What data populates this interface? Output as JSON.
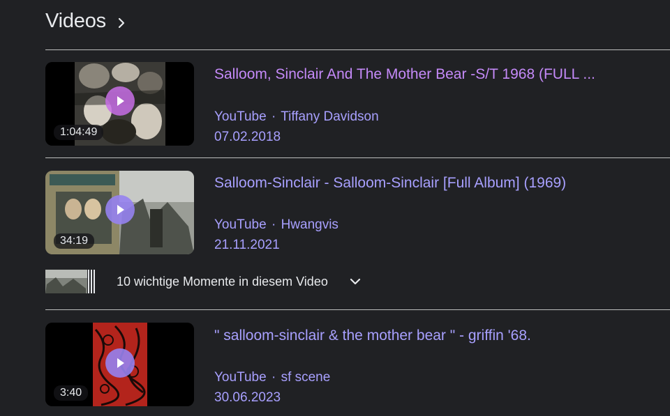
{
  "header": {
    "title": "Videos",
    "chevron_icon": "chevron-right-icon"
  },
  "colors": {
    "background": "#202124",
    "visited_link": "#c58af9",
    "link": "#8ab4f8",
    "meta": "#a8a0ff",
    "text": "#e8eaed"
  },
  "videos": [
    {
      "title": "Salloom, Sinclair And The Mother Bear -S/T 1968 (FULL ...",
      "source": "YouTube",
      "separator": "·",
      "channel": "Tiffany Davidson",
      "date": "07.02.2018",
      "duration": "1:04:49",
      "play_icon": "play-icon",
      "visited": true
    },
    {
      "title": "Salloom-Sinclair - Salloom-Sinclair [Full Album] (1969)",
      "source": "YouTube",
      "separator": "·",
      "channel": "Hwangvis",
      "date": "21.11.2021",
      "duration": "34:19",
      "play_icon": "play-icon",
      "visited": false
    },
    {
      "title": "\" salloom-sinclair & the mother bear \" - griffin '68.",
      "source": "YouTube",
      "separator": "·",
      "channel": "sf scene",
      "date": "30.06.2023",
      "duration": "3:40",
      "play_icon": "play-icon",
      "visited": false
    }
  ],
  "key_moments": {
    "label": "10 wichtige Momente in diesem Video",
    "expand_icon": "chevron-down-icon"
  }
}
